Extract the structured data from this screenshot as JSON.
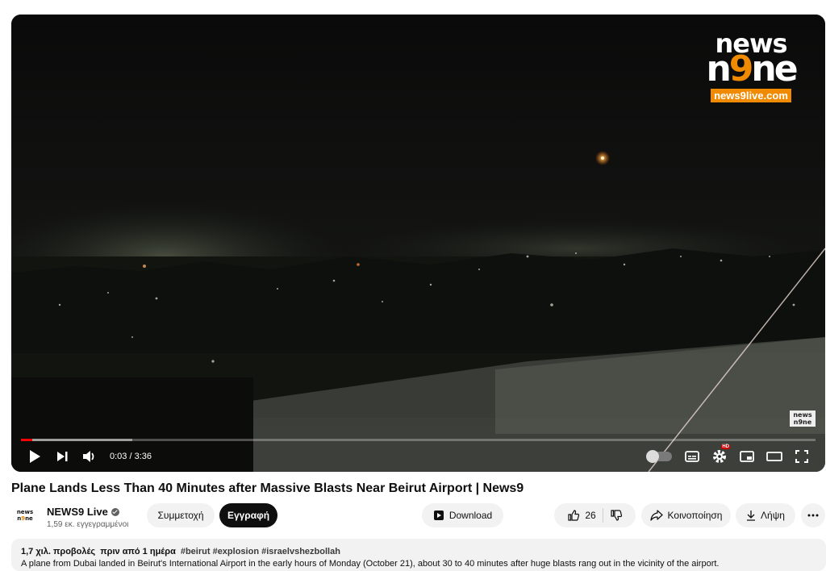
{
  "video": {
    "logo_top": "news",
    "logo_mid_left": "n",
    "logo_mid_accent": "9",
    "logo_mid_right": "ne",
    "logo_url": "news9live.com",
    "watermark_top": "news",
    "watermark_bottom": "n9ne",
    "progress_fraction": 0.014,
    "buffered_fraction": 0.14,
    "time": "0:03 / 3:36",
    "hd_badge": "HD"
  },
  "title": "Plane Lands Less Than 40 Minutes after Massive Blasts Near Beirut Airport | News9",
  "channel": {
    "avatar_top": "news",
    "avatar_left": "n",
    "avatar_accent": "9",
    "avatar_right": "ne",
    "name": "NEWS9 Live",
    "subscribers": "1,59 εκ. εγγεγραμμένοι",
    "join_label": "Συμμετοχή",
    "subscribe_label": "Εγγραφή"
  },
  "actions": {
    "download_label": "Download",
    "like_count": "26",
    "share_label": "Κοινοποίηση",
    "save_label": "Λήψη"
  },
  "description": {
    "meta": "1,7 χιλ. προβολές  πριν από 1 ημέρα",
    "tags": "#beirut #explosion #israelvshezbollah",
    "text": "A plane from Dubai landed in Beirut's International Airport in the early hours of Monday (October 21), about 30 to 40 minutes after huge blasts rang out in the vicinity of the airport."
  },
  "colors": {
    "brand_orange": "#f08a00",
    "progress_red": "#ff0000",
    "pill_gray": "#f2f2f2",
    "dark": "#0f0f0f"
  }
}
